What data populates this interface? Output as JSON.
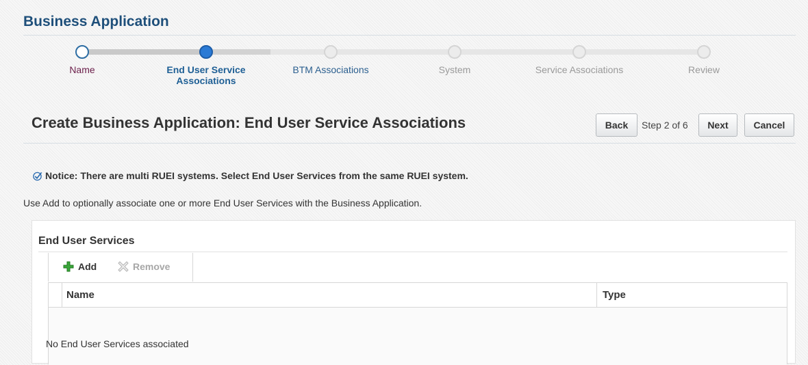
{
  "app_title": "Business Application",
  "train": {
    "steps": [
      {
        "label": "Name",
        "state": "visited"
      },
      {
        "label": "End User Service\nAssociations",
        "state": "current"
      },
      {
        "label": "BTM Associations",
        "state": "link"
      },
      {
        "label": "System",
        "state": "disabled"
      },
      {
        "label": "Service Associations",
        "state": "disabled"
      },
      {
        "label": "Review",
        "state": "disabled"
      }
    ]
  },
  "page_heading": "Create Business Application: End User Service Associations",
  "nav": {
    "back_label": "Back",
    "step_info": "Step 2 of 6",
    "next_label": "Next",
    "cancel_label": "Cancel"
  },
  "notice": {
    "icon": "checkmark-circle-icon",
    "text": "Notice: There are multi RUEI systems. Select End User Services from the same RUEI system."
  },
  "help_text": "Use Add to optionally associate one or more End User Services with the Business Application.",
  "panel": {
    "title": "End User Services",
    "toolbar": {
      "add_label": "Add",
      "add_icon": "plus-icon",
      "remove_label": "Remove",
      "remove_icon": "remove-x-icon"
    },
    "table": {
      "columns": [
        "Name",
        "Type"
      ],
      "empty_text": "No End User Services associated"
    }
  },
  "colors": {
    "title_blue": "#1e4f7a",
    "current_step": "#2a7ad5",
    "add_green": "#3aa63a"
  }
}
